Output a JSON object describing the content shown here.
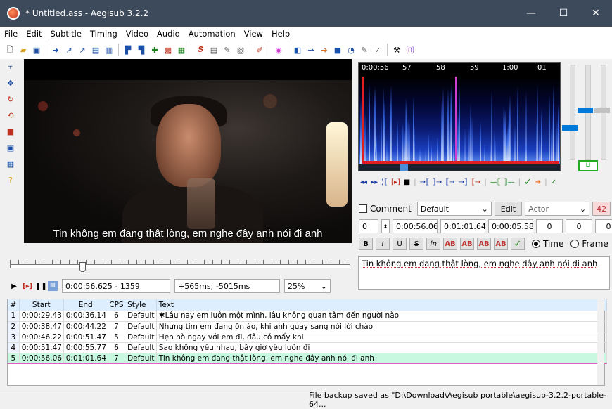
{
  "window": {
    "title": "* Untitled.ass - Aegisub 3.2.2"
  },
  "menu": [
    "File",
    "Edit",
    "Subtitle",
    "Timing",
    "Video",
    "Audio",
    "Automation",
    "View",
    "Help"
  ],
  "video": {
    "subtitle": "Tin không em đang thật lòng, em nghe đây anh nói đi anh"
  },
  "playback": {
    "position": "0:00:56.625 - 1359",
    "offset": "+565ms; -5015ms",
    "zoom": "25%"
  },
  "audio": {
    "ruler": [
      "0:00:56",
      "57",
      "58",
      "59",
      "1:00",
      "01"
    ]
  },
  "editor": {
    "comment_label": "Comment",
    "style": "Default",
    "edit_label": "Edit",
    "actor_placeholder": "Actor",
    "char_count": "42",
    "layer": "0",
    "start": "0:00:56.06",
    "end": "0:01:01.64",
    "duration": "0:00:05.58",
    "margin_l": "0",
    "margin_r": "0",
    "margin_v": "0",
    "time_label": "Time",
    "frame_label": "Frame",
    "text": "Tin không em đang thật lòng, em nghe đây anh nói đi anh"
  },
  "grid": {
    "headers": [
      "#",
      "Start",
      "End",
      "CPS",
      "Style",
      "Text"
    ],
    "rows": [
      {
        "n": "1",
        "start": "0:00:29.43",
        "end": "0:00:36.14",
        "cps": "6",
        "style": "Default",
        "text": "✱Lâu nay em luôn một mình, lâu không quan tâm đến người nào"
      },
      {
        "n": "2",
        "start": "0:00:38.47",
        "end": "0:00:44.22",
        "cps": "7",
        "style": "Default",
        "text": "Nhưng tim em đang ồn ào, khi anh quay sang nói lời chào"
      },
      {
        "n": "3",
        "start": "0:00:46.22",
        "end": "0:00:51.47",
        "cps": "5",
        "style": "Default",
        "text": "Hẹn hò ngay với em đi, đâu có mấy khi"
      },
      {
        "n": "4",
        "start": "0:00:51.47",
        "end": "0:00:55.77",
        "cps": "6",
        "style": "Default",
        "text": "Sao không yêu nhau, bây giờ yêu luôn đi"
      },
      {
        "n": "5",
        "start": "0:00:56.06",
        "end": "0:01:01.64",
        "cps": "7",
        "style": "Default",
        "text": "Tin không em đang thật lòng, em nghe đây anh nói đi anh"
      }
    ]
  },
  "status": {
    "text": "File backup saved as \"D:\\Download\\Aegisub portable\\aegisub-3.2.2-portable-64..."
  }
}
